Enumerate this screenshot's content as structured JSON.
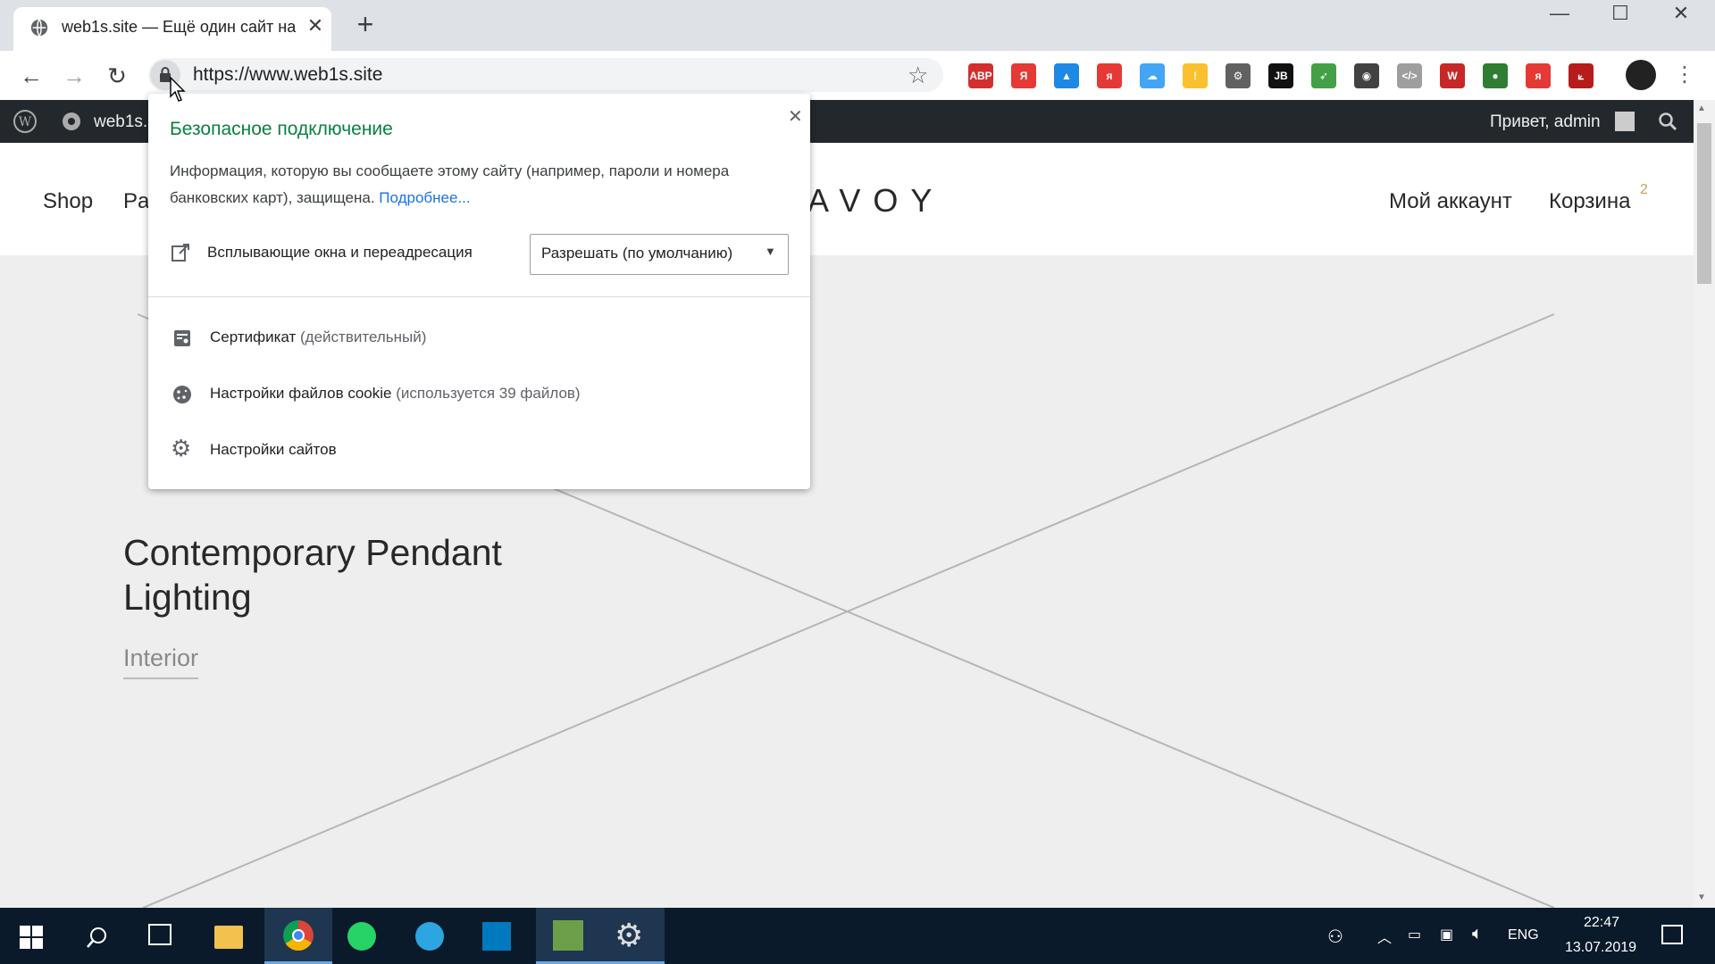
{
  "browser": {
    "tab_title": "web1s.site — Ещё один сайт на",
    "url": "https://www.web1s.site"
  },
  "wp_admin_bar": {
    "site_name": "web1s.s",
    "greeting": "Привет, admin"
  },
  "site_header": {
    "nav_left": [
      "Shop",
      "Pa"
    ],
    "logo_partial": "AVOY",
    "account_link": "Мой аккаунт",
    "cart_label": "Корзина",
    "cart_count": "2"
  },
  "hero": {
    "title_line1": "Contemporary Pendant",
    "title_line2": "Lighting",
    "category": "Interior"
  },
  "site_info_popup": {
    "title": "Безопасное подключение",
    "description": "Информация, которую вы сообщаете этому сайту (например, пароли и номера банковских карт), защищена.",
    "learn_more": "Подробнее...",
    "popups_label": "Всплывающие окна и переадресация",
    "popups_value": "Разрешать (по умолчанию)",
    "certificate_label": "Сертификат",
    "certificate_status": "(действительный)",
    "cookies_label": "Настройки файлов cookie",
    "cookies_status": "(используется 39 файлов)",
    "site_settings_label": "Настройки сайтов"
  },
  "extensions": [
    {
      "icon": "adblock-icon",
      "text": "ABP",
      "color": "#d32f2f"
    },
    {
      "icon": "yandex-icon",
      "text": "Я",
      "color": "#e53935"
    },
    {
      "icon": "drive-icon",
      "text": "▲",
      "color": "#1e88e5"
    },
    {
      "icon": "yandex-small-icon",
      "text": "я",
      "color": "#e53935"
    },
    {
      "icon": "cloud-icon",
      "text": "☁",
      "color": "#42a5f5"
    },
    {
      "icon": "keep-icon",
      "text": "!",
      "color": "#fbc02d"
    },
    {
      "icon": "gear-ext-icon",
      "text": "⚙",
      "color": "#616161"
    },
    {
      "icon": "jb-icon",
      "text": "JB",
      "color": "#111111"
    },
    {
      "icon": "rocket-icon",
      "text": "➶",
      "color": "#43a047"
    },
    {
      "icon": "mask-icon",
      "text": "◉",
      "color": "#424242"
    },
    {
      "icon": "code-icon",
      "text": "</>",
      "color": "#9e9e9e"
    },
    {
      "icon": "w-icon",
      "text": "W",
      "color": "#c62828"
    },
    {
      "icon": "globe-ext-icon",
      "text": "●",
      "color": "#2e7d32"
    },
    {
      "icon": "yandex-red-icon",
      "text": "я",
      "color": "#e53935"
    },
    {
      "icon": "pdf-icon",
      "text": "⟀",
      "color": "#b71c1c"
    }
  ],
  "taskbar": {
    "language": "ENG",
    "time": "22:47",
    "date": "13.07.2019"
  },
  "colors": {
    "secure_green": "#0b8043",
    "link_blue": "#1a73e8",
    "cart_badge": "#c7a35b",
    "wp_bar": "#23282d"
  }
}
